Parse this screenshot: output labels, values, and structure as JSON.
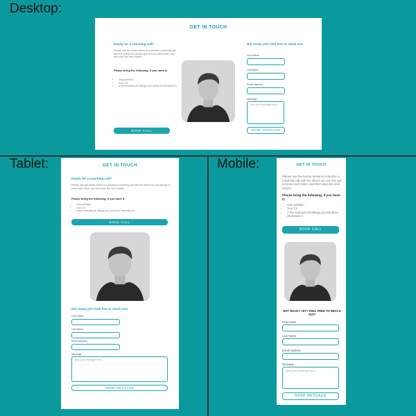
{
  "labels": {
    "desktop": "Desktop:",
    "tablet": "Tablet:",
    "mobile": "Mobile:"
  },
  "colors": {
    "background": "#0a9a9e",
    "accent": "#1ba4ad"
  },
  "contact": {
    "title": "GET IN TOUCH",
    "coaching_heading": "Ready for a coaching call?",
    "coaching_text": "Please use the button below to schedule a coaching call with me where we can first get to know each other, and then plan the next moves.",
    "bring_heading": "Please bring the following, if you have it:",
    "bring_items": [
      "Your portfolio",
      "Your CV",
      "A few example job listings you would be interested in"
    ],
    "book_button": "BOOK CALL",
    "form_heading": "Not ready yet? Feel free to reach out!",
    "form_heading_mobile": "NOT READY YET? FEEL FREE TO REACH OUT!",
    "fields": {
      "first_name": "First Name",
      "last_name": "Last Name",
      "email": "Email Address",
      "message": "Message"
    },
    "message_placeholder": "Type your message here...",
    "send_button": "SEND MESSAGE"
  },
  "icons": {
    "portrait": "portrait-photo"
  }
}
